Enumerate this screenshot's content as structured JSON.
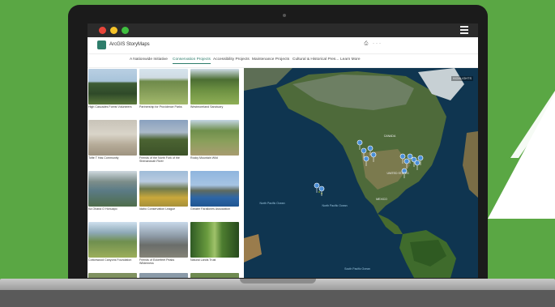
{
  "window": {
    "traffic_lights": [
      "#e9453a",
      "#f5c228",
      "#3fbf3f"
    ]
  },
  "app": {
    "title": "ArcGIS StoryMaps",
    "actions": "⎙  ···"
  },
  "nav": {
    "items": [
      "A Nationwide Initiative",
      "Conservation Projects",
      "Accessibility Projects",
      "Maintenance Projects",
      "Cultural & Historical Pres...",
      "Learn More"
    ],
    "active_index": 1
  },
  "gallery": {
    "items": [
      {
        "caption": "High Cascades Forest Volunteers"
      },
      {
        "caption": "Partnership for Providence Parks"
      },
      {
        "caption": "Westmoreland Sanctuary"
      },
      {
        "caption": "Tofte T Has Community"
      },
      {
        "caption": "Friends of the North Fork of the Shenandoah River"
      },
      {
        "caption": "Rocky Mountain Wild"
      },
      {
        "caption": "Ka Ohana O Honuapo"
      },
      {
        "caption": "Idaho Conservation League"
      },
      {
        "caption": "Greater Farallones Association"
      },
      {
        "caption": "Cottonwood Canyons Foundation"
      },
      {
        "caption": "Friends of Eckerfeet Peaks Wilderness"
      },
      {
        "caption": "Natural Lands Trust"
      }
    ]
  },
  "map": {
    "attribution": "HIGHLIGHTS",
    "labels": {
      "north_pacific": "North Pacific Ocean",
      "south_pacific": "South Pacific Ocean",
      "north_atlantic": "North Atlantic Ocean",
      "canada": "CANADA",
      "united_states": "UNITED STATES",
      "mexico": "MEXICO"
    }
  }
}
